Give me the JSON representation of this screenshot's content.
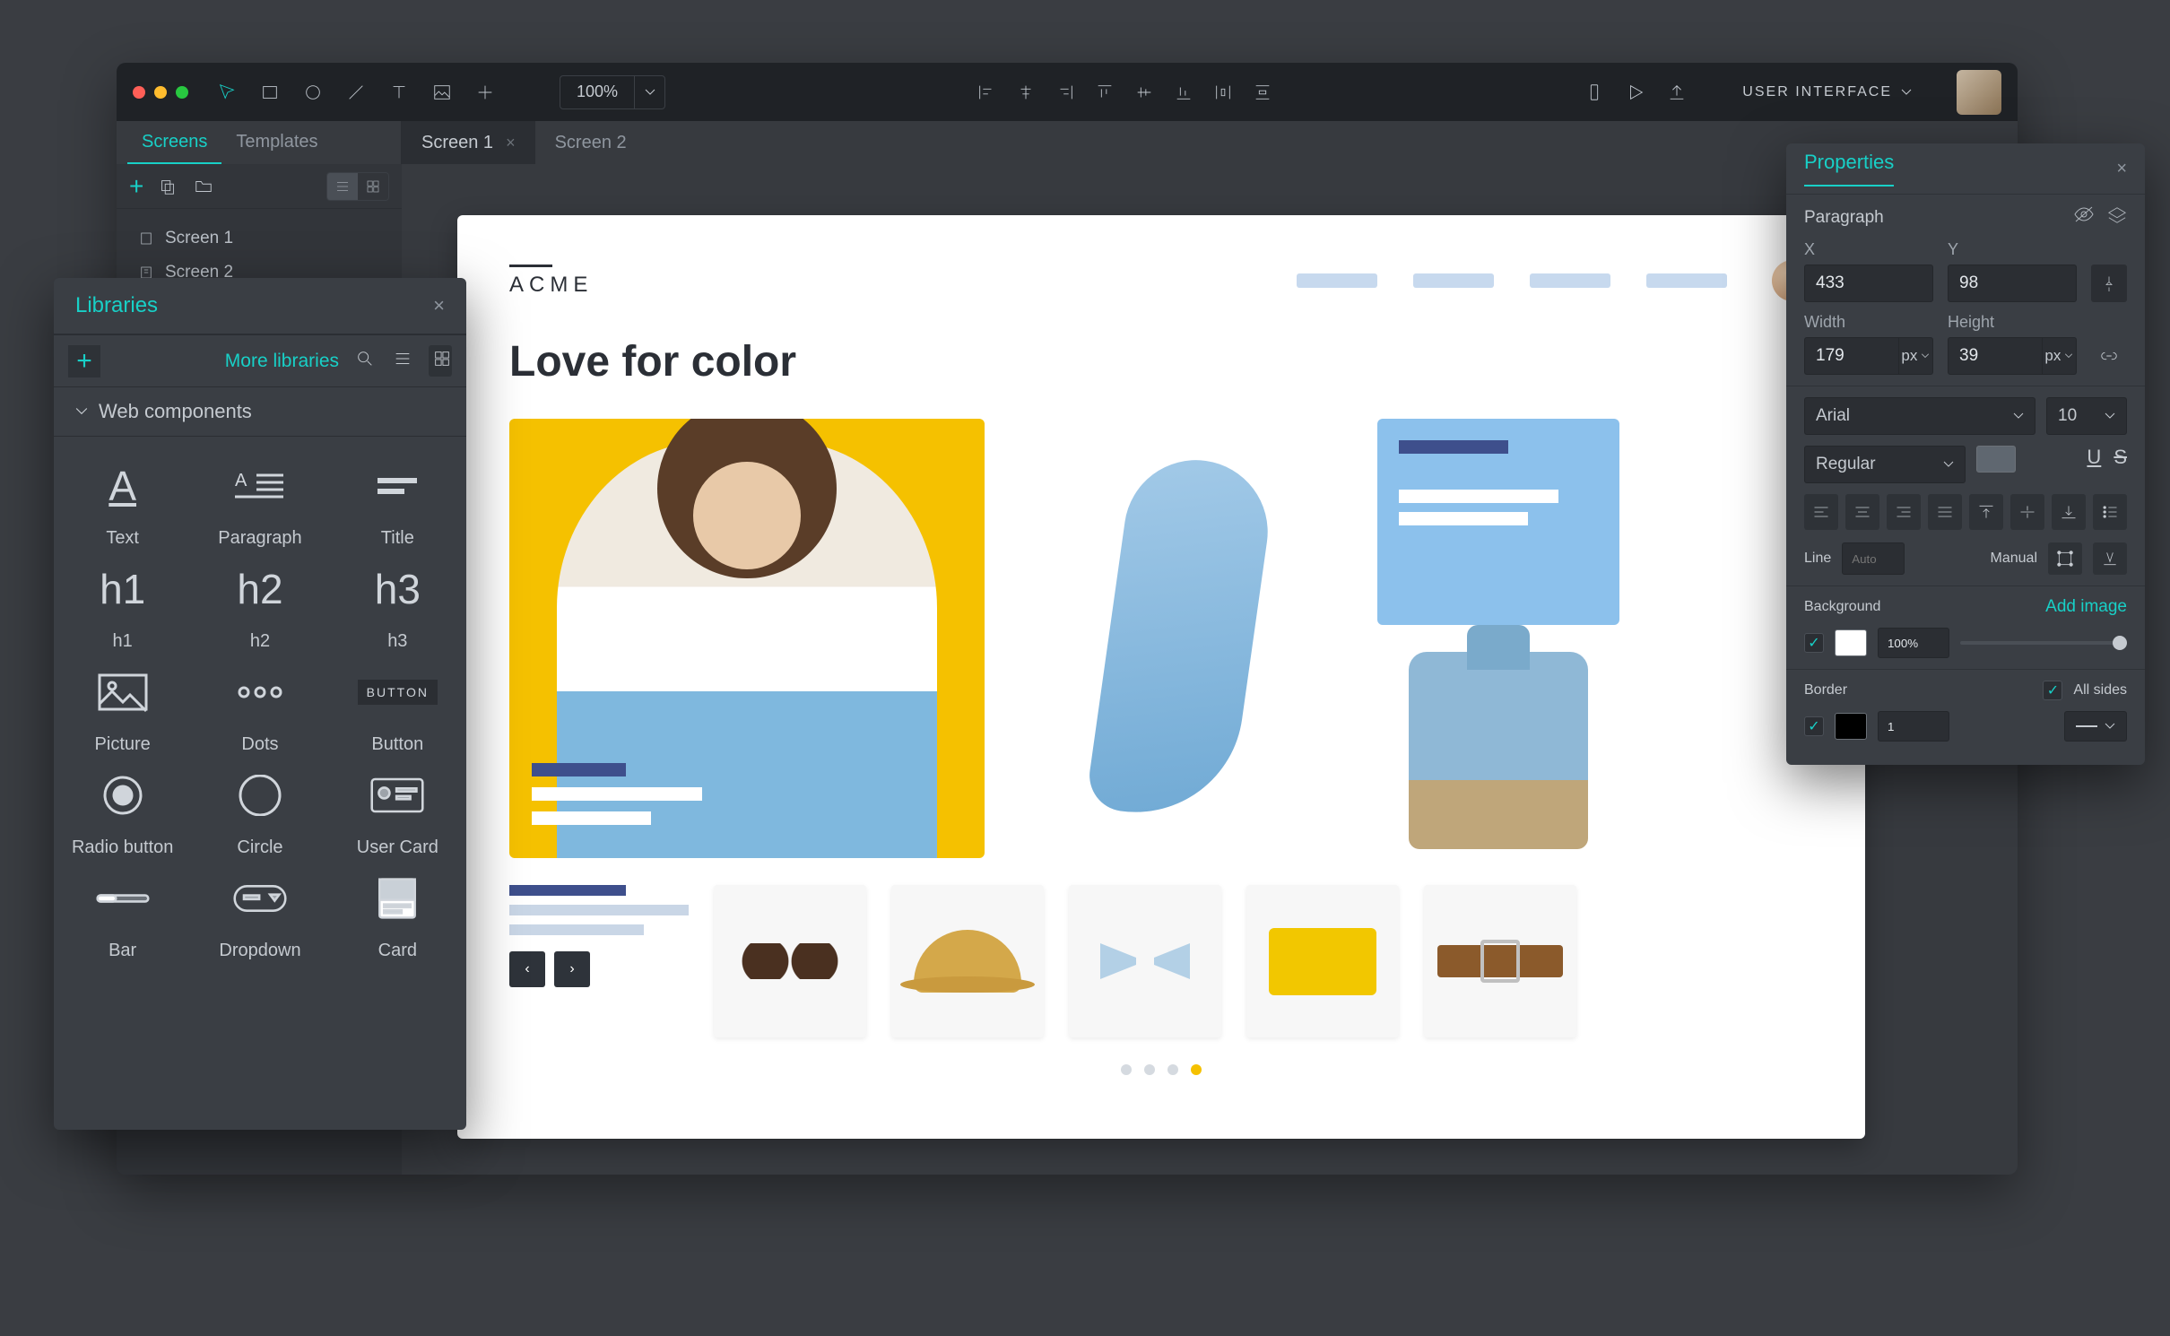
{
  "topbar": {
    "zoom": "100%",
    "project_label": "USER INTERFACE"
  },
  "sidebar_tabs": {
    "screens": "Screens",
    "templates": "Templates"
  },
  "doc_tabs": [
    {
      "label": "Screen 1",
      "active": true
    },
    {
      "label": "Screen 2",
      "active": false
    }
  ],
  "screen_list": [
    "Screen 1",
    "Screen 2"
  ],
  "libraries": {
    "title": "Libraries",
    "more": "More libraries",
    "section": "Web components",
    "items": [
      {
        "key": "text",
        "label": "Text"
      },
      {
        "key": "paragraph",
        "label": "Paragraph"
      },
      {
        "key": "title",
        "label": "Title"
      },
      {
        "key": "h1",
        "label": "h1"
      },
      {
        "key": "h2",
        "label": "h2"
      },
      {
        "key": "h3",
        "label": "h3"
      },
      {
        "key": "picture",
        "label": "Picture"
      },
      {
        "key": "dots",
        "label": "Dots"
      },
      {
        "key": "button",
        "label": "Button"
      },
      {
        "key": "radio",
        "label": "Radio button"
      },
      {
        "key": "circle",
        "label": "Circle"
      },
      {
        "key": "usercard",
        "label": "User Card"
      },
      {
        "key": "bar",
        "label": "Bar"
      },
      {
        "key": "dropdown",
        "label": "Dropdown"
      },
      {
        "key": "card",
        "label": "Card"
      }
    ]
  },
  "properties": {
    "title": "Properties",
    "element": "Paragraph",
    "x_label": "X",
    "y_label": "Y",
    "x": "433",
    "y": "98",
    "width_label": "Width",
    "height_label": "Height",
    "width": "179",
    "height": "39",
    "unit": "px",
    "font_family": "Arial",
    "font_size": "10",
    "font_weight": "Regular",
    "line_label": "Line",
    "line_mode": "Auto",
    "manual_label": "Manual",
    "background_label": "Background",
    "add_image": "Add image",
    "bg_opacity": "100%",
    "border_label": "Border",
    "all_sides": "All sides",
    "border_width": "1",
    "bg_color": "#ffffff",
    "border_color": "#000000"
  },
  "canvas": {
    "brand": "ACME",
    "headline": "Love for color",
    "thumbs": [
      "sunglasses",
      "hat",
      "bowtie",
      "clutch",
      "belt"
    ]
  }
}
